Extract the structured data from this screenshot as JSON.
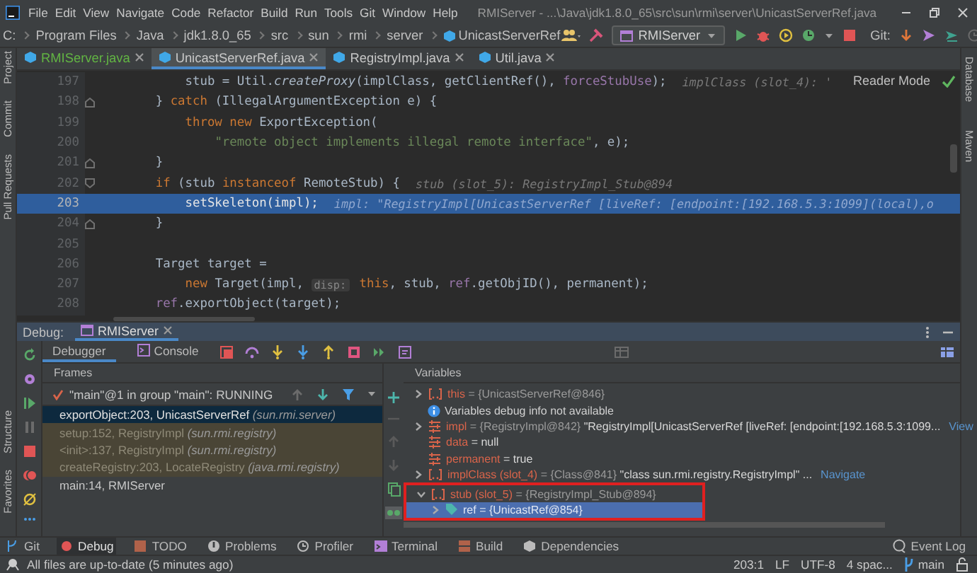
{
  "window": {
    "title": "RMIServer - ...\\Java\\jdk1.8.0_65\\src\\sun\\rmi\\server\\UnicastServerRef.java"
  },
  "menu": [
    "File",
    "Edit",
    "View",
    "Navigate",
    "Code",
    "Refactor",
    "Build",
    "Run",
    "Tools",
    "Git",
    "Window",
    "Help"
  ],
  "breadcrumb": [
    {
      "label": "C:",
      "kind": "folder"
    },
    {
      "label": "Program Files",
      "kind": "folder"
    },
    {
      "label": "Java",
      "kind": "folder"
    },
    {
      "label": "jdk1.8.0_65",
      "kind": "folder"
    },
    {
      "label": "src",
      "kind": "folder"
    },
    {
      "label": "sun",
      "kind": "folder"
    },
    {
      "label": "rmi",
      "kind": "folder"
    },
    {
      "label": "server",
      "kind": "folder"
    },
    {
      "label": "UnicastServerRef",
      "kind": "class"
    }
  ],
  "run_config": "RMIServer",
  "git_label": "Git:",
  "left_tool_strip": {
    "top": [
      "Project",
      "Commit",
      "Pull Requests"
    ],
    "bottom": [
      "Structure",
      "Favorites"
    ]
  },
  "right_tool_strip": [
    "Database",
    "Maven"
  ],
  "editor_tabs": [
    {
      "label": "RMIServer.java",
      "selected": false,
      "vcs_added": true
    },
    {
      "label": "UnicastServerRef.java",
      "selected": true,
      "vcs_added": false
    },
    {
      "label": "RegistryImpl.java",
      "selected": false,
      "vcs_added": false
    },
    {
      "label": "Util.java",
      "selected": false,
      "vcs_added": false
    }
  ],
  "reader_mode": "Reader Mode",
  "code_lines": [
    {
      "number": "197",
      "current": false,
      "fold_start": false,
      "fold_end": false,
      "tokens": [
        {
          "kind": "plain",
          "text": "            stub = Util."
        },
        {
          "kind": "method",
          "text": "createProxy"
        },
        {
          "kind": "plain",
          "text": "(implClass, getClientRef(), "
        },
        {
          "kind": "field",
          "text": "forceStubUse"
        },
        {
          "kind": "plain",
          "text": ");"
        },
        {
          "kind": "hint",
          "text": "implClass (slot_4): '"
        }
      ]
    },
    {
      "number": "198",
      "current": false,
      "fold_start": false,
      "fold_end": true,
      "tokens": [
        {
          "kind": "plain",
          "text": "        } "
        },
        {
          "kind": "keyword",
          "text": "catch"
        },
        {
          "kind": "plain",
          "text": " (IllegalArgumentException e) {"
        }
      ]
    },
    {
      "number": "199",
      "current": false,
      "fold_start": false,
      "fold_end": false,
      "tokens": [
        {
          "kind": "keyword",
          "text": "            throw new"
        },
        {
          "kind": "plain",
          "text": " ExportException("
        }
      ]
    },
    {
      "number": "200",
      "current": false,
      "fold_start": false,
      "fold_end": false,
      "tokens": [
        {
          "kind": "string",
          "text": "                \"remote object implements illegal remote interface\""
        },
        {
          "kind": "plain",
          "text": ", e);"
        }
      ]
    },
    {
      "number": "201",
      "current": false,
      "fold_start": false,
      "fold_end": true,
      "tokens": [
        {
          "kind": "plain",
          "text": "        }"
        }
      ]
    },
    {
      "number": "202",
      "current": false,
      "fold_start": true,
      "fold_end": false,
      "tokens": [
        {
          "kind": "keyword",
          "text": "        if"
        },
        {
          "kind": "plain",
          "text": " (stub "
        },
        {
          "kind": "keyword",
          "text": "instanceof"
        },
        {
          "kind": "plain",
          "text": " RemoteStub) {"
        },
        {
          "kind": "hint",
          "text": "stub (slot_5): RegistryImpl_Stub@894"
        }
      ]
    },
    {
      "number": "203",
      "current": true,
      "fold_start": false,
      "fold_end": false,
      "tokens": [
        {
          "kind": "plain",
          "text": "            setSkeleton(impl);"
        },
        {
          "kind": "hint",
          "text": "impl: \"RegistryImpl[UnicastServerRef [liveRef: [endpoint:[192.168.5.3:1099](local),o"
        }
      ]
    },
    {
      "number": "204",
      "current": false,
      "fold_start": false,
      "fold_end": true,
      "tokens": [
        {
          "kind": "plain",
          "text": "        }"
        }
      ]
    },
    {
      "number": "205",
      "current": false,
      "fold_start": false,
      "fold_end": false
    },
    {
      "number": "206",
      "current": false,
      "fold_start": false,
      "fold_end": false,
      "tokens": [
        {
          "kind": "plain",
          "text": "        Target target ="
        }
      ]
    },
    {
      "number": "207",
      "current": false,
      "fold_start": false,
      "fold_end": false,
      "tokens": [
        {
          "kind": "keyword",
          "text": "            new"
        },
        {
          "kind": "plain",
          "text": " Target(impl, "
        },
        {
          "kind": "param",
          "text": "disp:"
        },
        {
          "kind": "keyword",
          "text": " this"
        },
        {
          "kind": "plain",
          "text": ", stub, "
        },
        {
          "kind": "field",
          "text": "ref"
        },
        {
          "kind": "plain",
          "text": ".getObjID(), permanent);"
        }
      ]
    },
    {
      "number": "208",
      "current": false,
      "fold_start": false,
      "fold_end": false,
      "tokens": [
        {
          "kind": "field",
          "text": "        ref"
        },
        {
          "kind": "plain",
          "text": ".exportObject(target);"
        }
      ]
    }
  ],
  "debug": {
    "title": "Debug:",
    "session_tab": "RMIServer",
    "tabs": [
      {
        "label": "Debugger",
        "selected": true
      },
      {
        "label": "Console",
        "selected": false
      }
    ],
    "frames_header": "Frames",
    "thread": "\"main\"@1 in group \"main\": RUNNING",
    "frames": [
      {
        "method": "exportObject:203, UnicastServerRef",
        "package": "(sun.rmi.server)",
        "selected": true,
        "library": false
      },
      {
        "method": "setup:152, RegistryImpl",
        "package": "(sun.rmi.registry)",
        "selected": false,
        "library": true
      },
      {
        "method": "<init>:137, RegistryImpl",
        "package": "(sun.rmi.registry)",
        "selected": false,
        "library": true
      },
      {
        "method": "createRegistry:203, LocateRegistry",
        "package": "(java.rmi.registry)",
        "selected": false,
        "library": true
      },
      {
        "method": "main:14, RMIServer",
        "selected": false,
        "library": false
      }
    ],
    "variables_header": "Variables",
    "variables": [
      {
        "kind": "object",
        "name": "this",
        "value": "= {UnicastServerRef@846}",
        "expanded": false,
        "selected": false
      },
      {
        "kind": "info",
        "text": "Variables debug info not available",
        "selected": false
      },
      {
        "kind": "field",
        "name": "impl",
        "value": "= {RegistryImpl@842}",
        "text": "\"RegistryImpl[UnicastServerRef [liveRef: [endpoint:[192.168.5.3:1099...",
        "link": "View",
        "expanded": false,
        "selected": false
      },
      {
        "kind": "field",
        "name": "data",
        "text": "= null",
        "selected": false
      },
      {
        "kind": "field",
        "name": "permanent",
        "text": "= true",
        "selected": false
      },
      {
        "kind": "object",
        "name": "implClass (slot_4)",
        "value": "= {Class@841}",
        "text": "\"class sun.rmi.registry.RegistryImpl\" ...",
        "link": "Navigate",
        "expanded": false,
        "selected": false
      },
      {
        "kind": "object",
        "name": "stub (slot_5)",
        "value": "= {RegistryImpl_Stub@894}",
        "expanded": true,
        "selected": false,
        "annotated": true,
        "children": [
          {
            "kind": "ref",
            "name": "ref",
            "value": "= {UnicastRef@854}",
            "expanded": false,
            "selected": true
          }
        ]
      }
    ]
  },
  "tool_tabs": [
    {
      "label": "Git",
      "selected": false
    },
    {
      "label": "Debug",
      "selected": true
    },
    {
      "label": "TODO",
      "selected": false
    },
    {
      "label": "Problems",
      "selected": false
    },
    {
      "label": "Profiler",
      "selected": false
    },
    {
      "label": "Terminal",
      "selected": false
    },
    {
      "label": "Build",
      "selected": false
    },
    {
      "label": "Dependencies",
      "selected": false
    }
  ],
  "event_log": "Event Log",
  "status_bar": {
    "message": "All files are up-to-date (5 minutes ago)",
    "position": "203:1",
    "line_ending": "LF",
    "encoding": "UTF-8",
    "indent": "4 spac...",
    "branch": "main"
  }
}
